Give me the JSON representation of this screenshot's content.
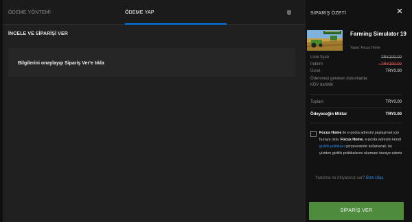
{
  "tabs": [
    {
      "label": "ÖDEME YÖNTEMİ"
    },
    {
      "label": "ÖDEME YAP"
    }
  ],
  "review": {
    "title": "İNCELE VE SİPARİŞİ VER",
    "instruction": "Bilgilerini onaylayıp Sipariş Ver'e tıkla"
  },
  "summary": {
    "title": "SİPARİŞ ÖZETİ",
    "close_glyph": "✕",
    "game_title": "Farming Simulator 19",
    "publisher": "Yazar: Focus Home",
    "rows": [
      {
        "label": "Liste fiyatı",
        "value": "TRY100.00"
      },
      {
        "label": "İndirim",
        "value": "- TRY100.00"
      },
      {
        "label": "Ücret",
        "value": "TRY0.00"
      }
    ],
    "tax_note": "Ödenmesi gereken durumlarda KDV dahildir",
    "total_label": "Toplam",
    "total_value": "TRY0.00",
    "pay_label": "Ödeyeceğin Miktar",
    "pay_value": "TRY0.00",
    "consent": {
      "publisher": "Focus Home",
      "text_1": "ile e-posta adresini paylaşmak için buraya tıkla.",
      "publisher_2": "Focus Home",
      "text_2": ", e-posta adresini kendi",
      "policy_link": "gizlilik politikası",
      "text_3": "çerçevesinde kullanacak; bu yüzden gizlilik politikalarını okumanı tavsiye ederiz."
    },
    "help_text": "Yardıma mı ihtiyacınız var?",
    "help_link": "Bize Ulaş",
    "buy_label": "SİPARİŞ VER"
  },
  "colors": {
    "accent": "#0078f2",
    "link": "#2f8be9",
    "buy_button": "#4e8b3d",
    "discount": "#d95555"
  },
  "icons": [
    "shield-icon",
    "close-icon"
  ]
}
